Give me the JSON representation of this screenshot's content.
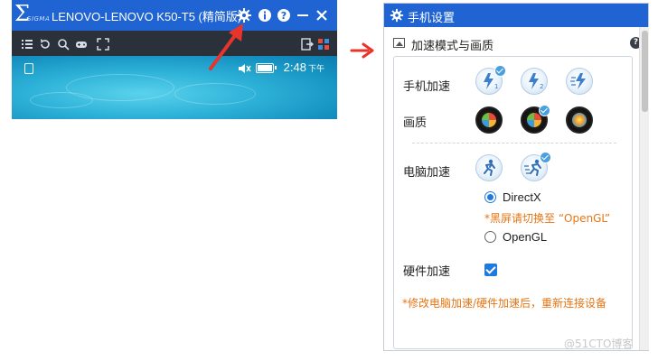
{
  "phone_window": {
    "title": "LENOVO-LENOVO K50-T5 (精简版)",
    "logo_text": "SIGMA",
    "status_time": "2:48",
    "status_afternoon": "下午"
  },
  "settings_panel": {
    "header_title": "手机设置",
    "section_title": "加速模式与画质",
    "phone_accel_label": "手机加速",
    "quality_label": "画质",
    "pc_accel_label": "电脑加速",
    "directx_label": "DirectX",
    "directx_hint": "*黑屏请切换至 “OpenGL”",
    "opengl_label": "OpenGL",
    "hw_accel_label": "硬件加速",
    "restart_hint": "*修改电脑加速/硬件加速后，重新连接设备",
    "renderer_selected": "DirectX",
    "hw_accel_checked": true
  },
  "watermark": "@51CTO博客",
  "colors": {
    "titlebar_blue": "#1f64d2",
    "accent_orange": "#e67514",
    "arrow_red": "#e8342a"
  }
}
